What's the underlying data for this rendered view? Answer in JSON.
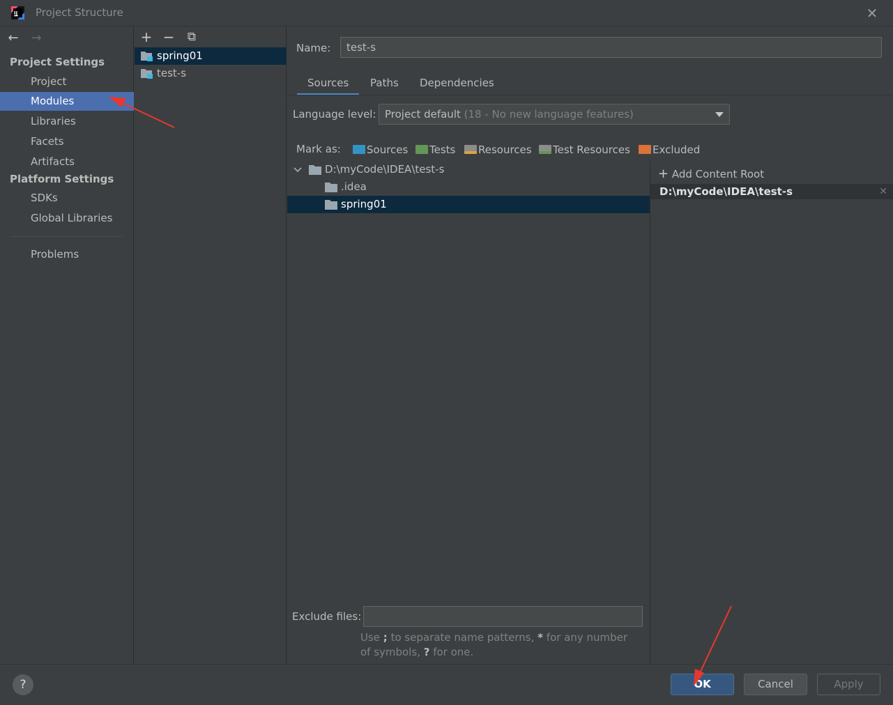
{
  "window": {
    "title": "Project Structure",
    "close_glyph": "✕"
  },
  "nav": {
    "back_glyph": "←",
    "forward_glyph": "→"
  },
  "sidebar": {
    "project_settings_header": "Project Settings",
    "project_items": [
      {
        "label": "Project"
      },
      {
        "label": "Modules",
        "selected": true
      },
      {
        "label": "Libraries"
      },
      {
        "label": "Facets"
      },
      {
        "label": "Artifacts"
      }
    ],
    "platform_settings_header": "Platform Settings",
    "platform_items": [
      {
        "label": "SDKs"
      },
      {
        "label": "Global Libraries"
      }
    ],
    "problems_label": "Problems"
  },
  "module_toolbar": {
    "add_glyph": "+",
    "remove_glyph": "−",
    "copy_glyph": "⧉"
  },
  "modules": [
    {
      "label": "spring01",
      "selected": true
    },
    {
      "label": "test-s",
      "selected": false
    }
  ],
  "details": {
    "name_label": "Name:",
    "name_value": "test-s",
    "tabs": [
      {
        "label": "Sources",
        "active": true
      },
      {
        "label": "Paths"
      },
      {
        "label": "Dependencies"
      }
    ],
    "language_level_label": "Language level:",
    "language_level_value": "Project default",
    "language_level_hint": "(18 - No new language features)",
    "mark_as_label": "Mark as:",
    "mark_buttons": [
      {
        "label": "Sources",
        "color": "#3592c4"
      },
      {
        "label": "Tests",
        "color": "#629755"
      },
      {
        "label": "Resources",
        "color": "#8c8c8c"
      },
      {
        "label": "Test Resources",
        "color": "#8c8c8c"
      },
      {
        "label": "Excluded",
        "color": "#d97339"
      }
    ],
    "tree": {
      "root": "D:\\myCode\\IDEA\\test-s",
      "children": [
        {
          "label": ".idea",
          "selected": false
        },
        {
          "label": "spring01",
          "selected": true
        }
      ]
    },
    "add_content_root": "Add Content Root",
    "content_root_path": "D:\\myCode\\IDEA\\test-s",
    "exclude_files_label": "Exclude files:",
    "exclude_files_value": "",
    "exclude_hint": {
      "part1": "Use ",
      "semicolon": ";",
      "part2": " to separate name patterns, ",
      "star": "*",
      "part3": " for any number of symbols, ",
      "question": "?",
      "part4": " for one."
    }
  },
  "footer": {
    "help_glyph": "?",
    "ok_label": "OK",
    "cancel_label": "Cancel",
    "apply_label": "Apply"
  },
  "colors": {
    "background": "#3c3f41",
    "selection": "#4b6eaf",
    "tree_selection": "#0d293e",
    "ok_button": "#365880",
    "annotation_arrow": "#e8382b"
  }
}
